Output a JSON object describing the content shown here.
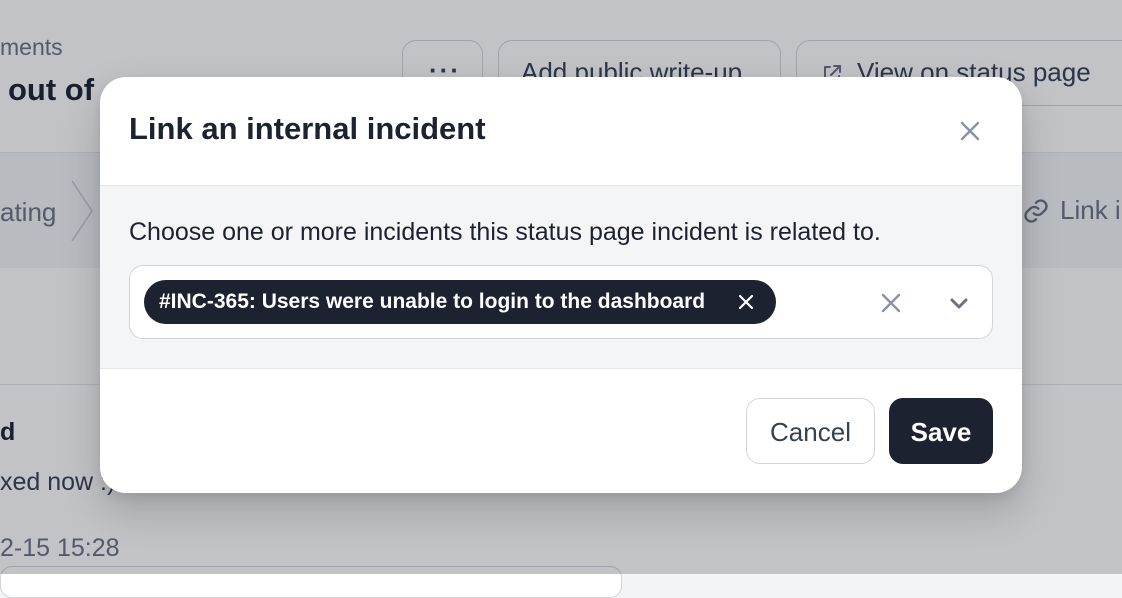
{
  "background": {
    "breadcrumb": "ments",
    "title": "out of",
    "more_button_label": "···",
    "write_up_button_label": "Add public write-up",
    "view_status_button_label": "View on status page",
    "status_step_label": "ating",
    "link_label": "Link i",
    "update_status": "d",
    "update_text": "xed now :)",
    "update_time": "2-15 15:28"
  },
  "modal": {
    "title": "Link an internal incident",
    "description": "Choose one or more incidents this status page incident is related to.",
    "selected_incidents": [
      "#INC-365: Users were unable to login to the dashboard"
    ],
    "cancel_label": "Cancel",
    "save_label": "Save"
  },
  "colors": {
    "primary": "#1c2230",
    "overlay": "rgba(17,24,39,0.26)",
    "body_muted": "#f4f5f7"
  },
  "icons": {
    "close": "close-icon",
    "chip_remove": "x-icon",
    "clear": "clear-icon",
    "dropdown": "chevron-down-icon",
    "external_link": "external-link-icon",
    "link": "link-icon"
  }
}
